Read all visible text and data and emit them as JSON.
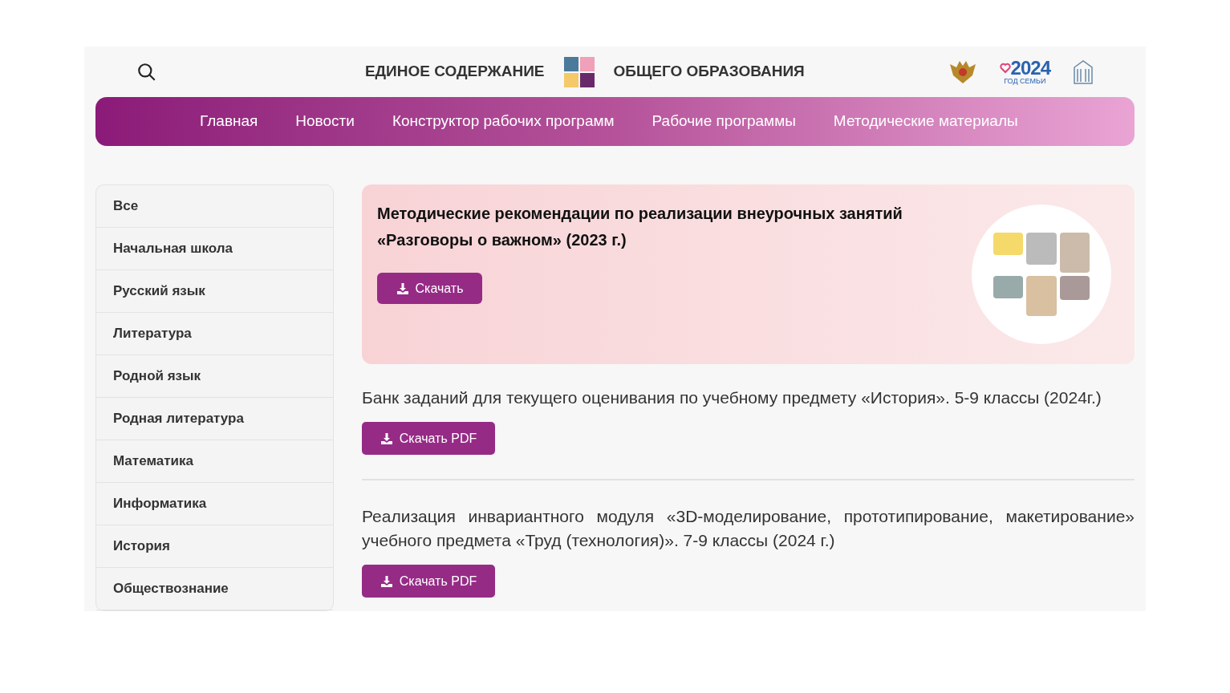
{
  "header": {
    "title_left": "ЕДИНОЕ СОДЕРЖАНИЕ",
    "title_right": "ОБЩЕГО ОБРАЗОВАНИЯ",
    "year_logo": {
      "year": "2024",
      "caption": "ГОД СЕМЬИ"
    }
  },
  "nav": [
    "Главная",
    "Новости",
    "Конструктор рабочих программ",
    "Рабочие программы",
    "Методические материалы"
  ],
  "sidebar": {
    "items": [
      "Все",
      "Начальная школа",
      "Русский язык",
      "Литература",
      "Родной язык",
      "Родная литература",
      "Математика",
      "Информатика",
      "История",
      "Обществознание"
    ]
  },
  "featured": {
    "title": "Методические рекомендации по реализации внеурочных занятий «Разговоры о важном» (2023 г.)",
    "button": "Скачать"
  },
  "materials": [
    {
      "title": "Банк заданий для текущего оценивания по учебному предмету «История». 5-9 классы (2024г.)",
      "button": "Скачать PDF"
    },
    {
      "title": "Реализация инвариантного модуля «3D-моделирование, прототипирование, макетирование» учебного предмета «Труд (технология)». 7-9 классы (2024 г.)",
      "button": "Скачать PDF"
    }
  ]
}
